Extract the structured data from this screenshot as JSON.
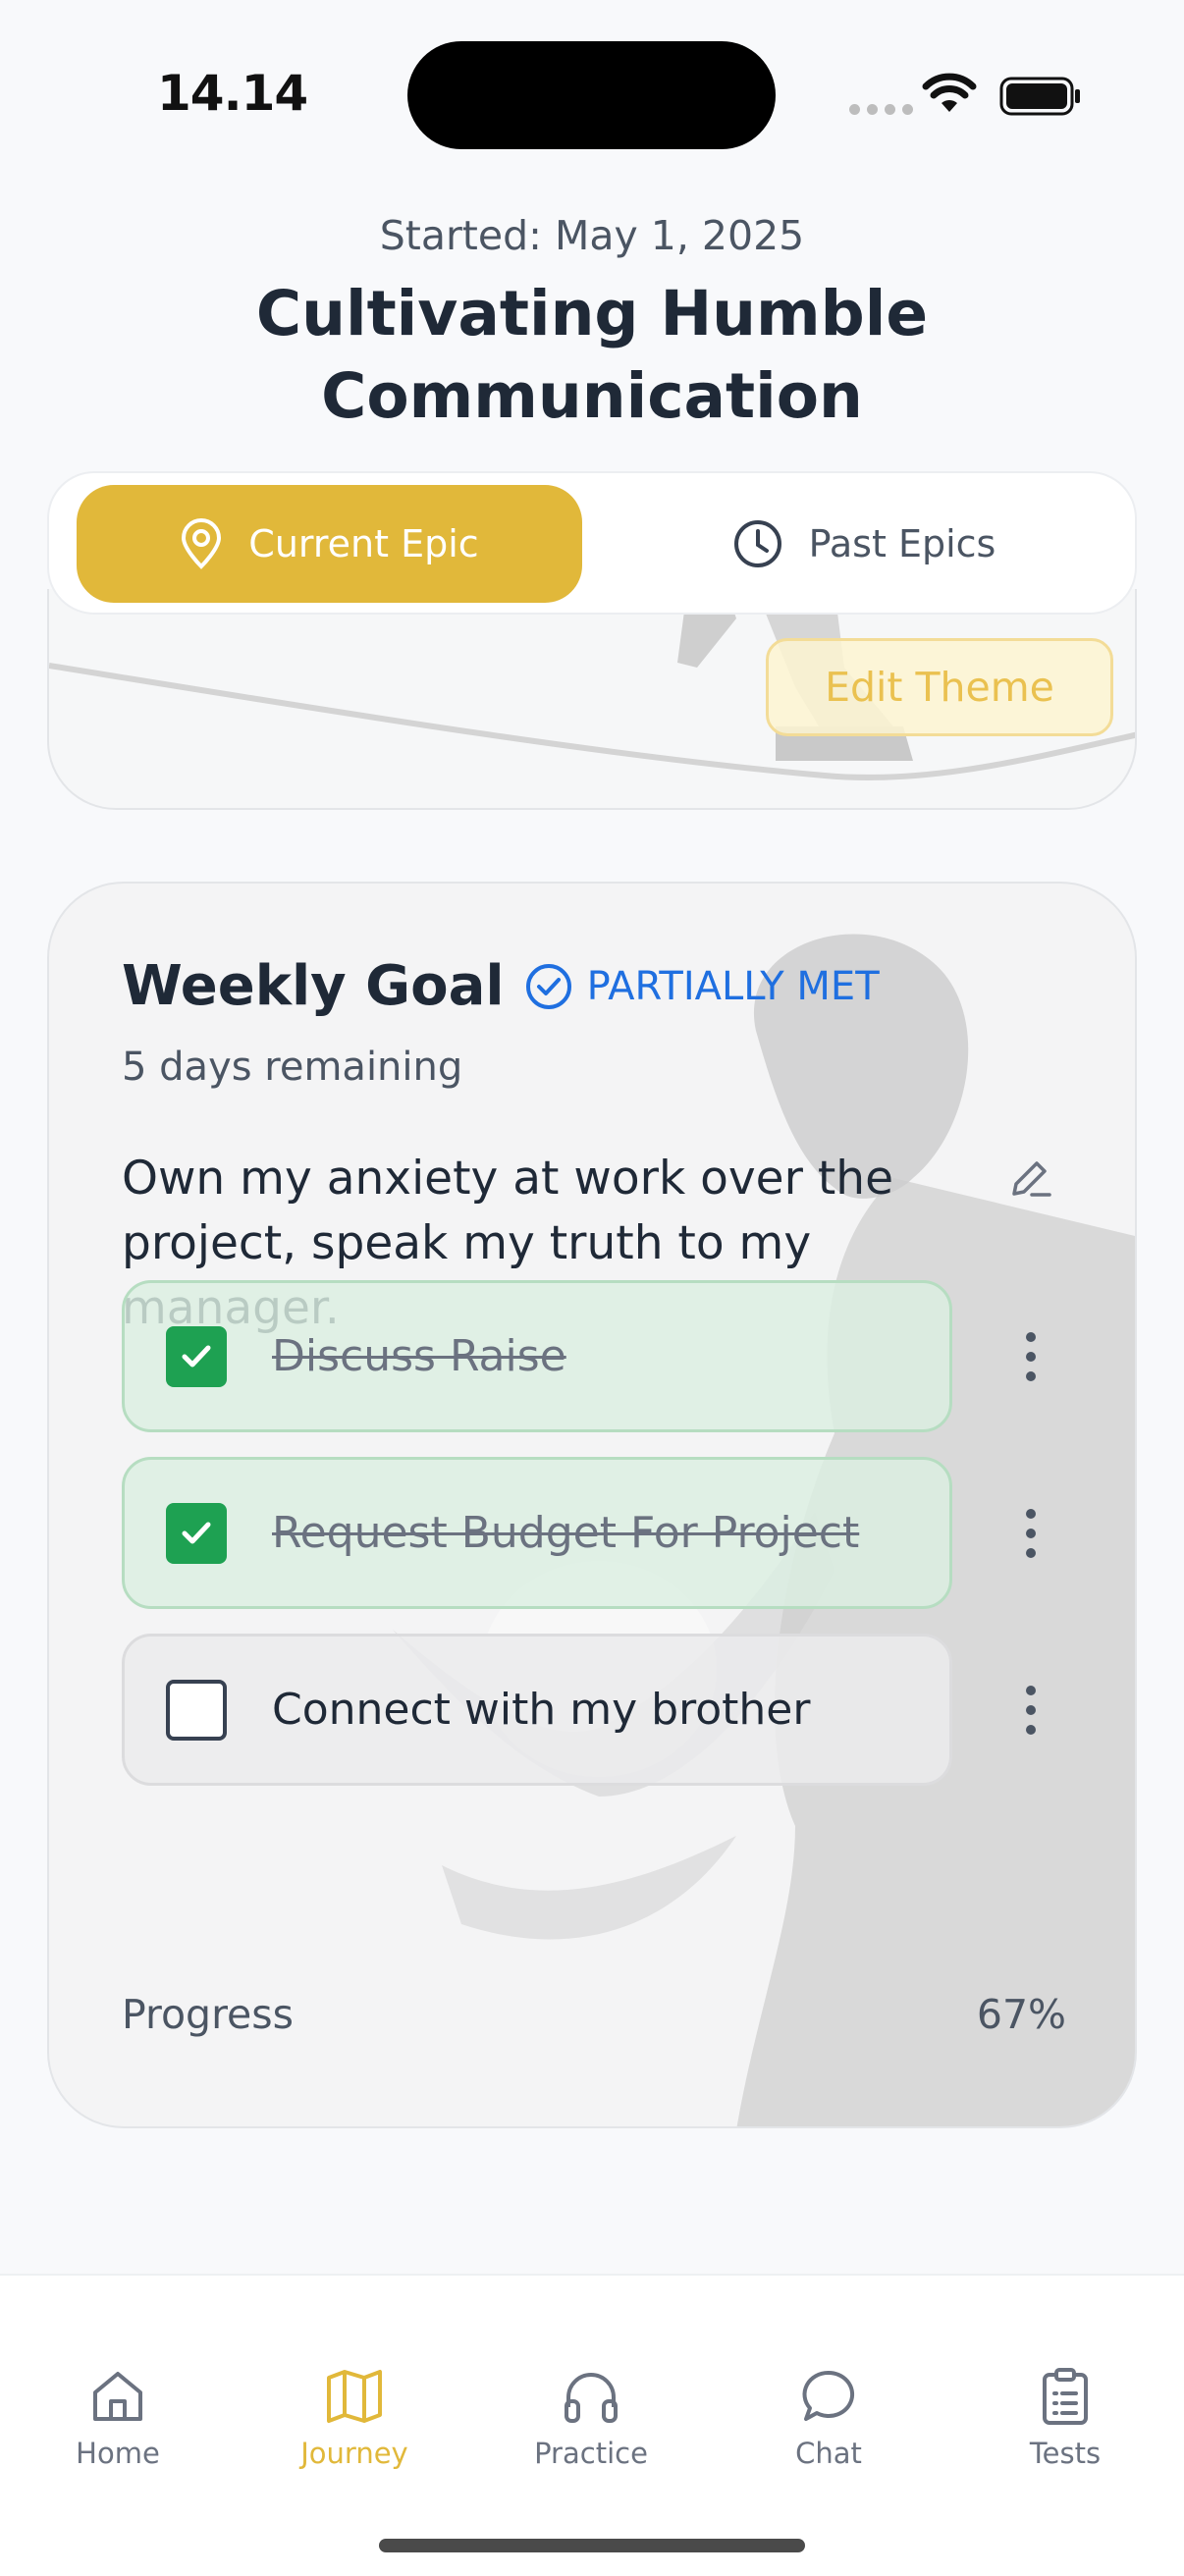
{
  "status_bar": {
    "time": "14.14"
  },
  "header": {
    "started": "Started: May 1, 2025",
    "title": "Cultivating Humble Communication"
  },
  "tabs": [
    {
      "label": "Current Epic",
      "icon": "map-pin-icon",
      "active": true
    },
    {
      "label": "Past Epics",
      "icon": "clock-icon",
      "active": false
    }
  ],
  "theme_card": {
    "edit_label": "Edit Theme"
  },
  "goal": {
    "title": "Weekly Goal",
    "status": "PARTIALLY MET",
    "days_remaining": "5 days remaining",
    "text": "Own my anxiety at work over the project, speak my truth to my manager.",
    "tasks": [
      {
        "label": "Discuss Raise",
        "done": true
      },
      {
        "label": "Request Budget For Project",
        "done": true
      },
      {
        "label": "Connect with my brother",
        "done": false
      }
    ],
    "progress_label": "Progress",
    "progress_value": "67%",
    "progress_fraction": 0.67
  },
  "nav": [
    {
      "label": "Home",
      "icon": "home-icon"
    },
    {
      "label": "Journey",
      "icon": "map-icon",
      "active": true
    },
    {
      "label": "Practice",
      "icon": "headphones-icon"
    },
    {
      "label": "Chat",
      "icon": "chat-bubble-icon"
    },
    {
      "label": "Tests",
      "icon": "clipboard-icon"
    }
  ],
  "colors": {
    "accent": "#e1b83a",
    "success": "#1ea152",
    "status_blue": "#1f6fe0"
  }
}
